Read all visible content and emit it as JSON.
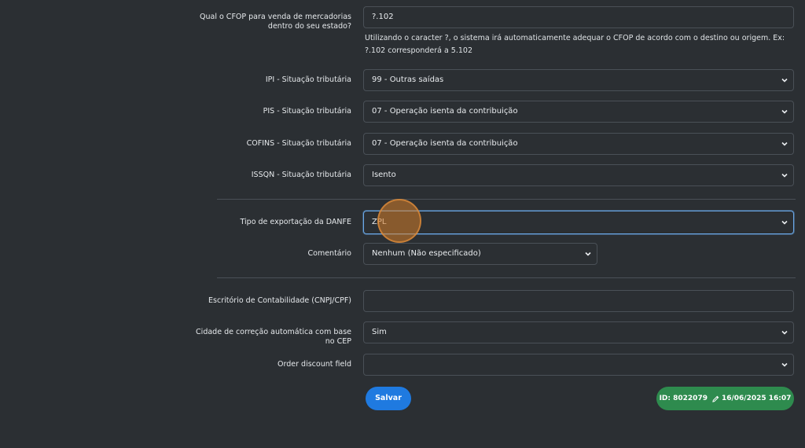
{
  "form": {
    "cfop": {
      "label": "Qual o CFOP para venda de mercadorias dentro do seu estado?",
      "value": "?.102",
      "help": "Utilizando o caracter ?, o sistema irá automaticamente adequar o CFOP de acordo com o destino ou origem. Ex: ?.102 corresponderá a 5.102"
    },
    "ipi": {
      "label": "IPI - Situação tributária",
      "value": "99 - Outras saídas"
    },
    "pis": {
      "label": "PIS - Situação tributária",
      "value": "07 - Operação isenta da contribuição"
    },
    "cofins": {
      "label": "COFINS - Situação tributária",
      "value": "07 - Operação isenta da contribuição"
    },
    "issqn": {
      "label": "ISSQN - Situação tributária",
      "value": "Isento"
    },
    "danfe": {
      "label": "Tipo de exportação da DANFE",
      "value": "ZPL"
    },
    "comentario": {
      "label": "Comentário",
      "value": "Nenhum (Não especificado)"
    },
    "escritorio": {
      "label": "Escritório de Contabilidade (CNPJ/CPF)",
      "value": ""
    },
    "cidade": {
      "label": "Cidade de correção automática com base no CEP",
      "value": "Sim"
    },
    "discount": {
      "label": "Order discount field",
      "value": ""
    }
  },
  "actions": {
    "save_label": "Salvar"
  },
  "record": {
    "id_text": "ID: 8022079",
    "timestamp": "16/06/2025 16:07"
  },
  "colors": {
    "background": "#2b2f33",
    "primary": "#1f7ae0",
    "success": "#2e8b4e",
    "focus": "#6aa8e8"
  },
  "icons": {
    "select_chevron": "chevron-down-icon",
    "edit": "pencil-icon"
  }
}
